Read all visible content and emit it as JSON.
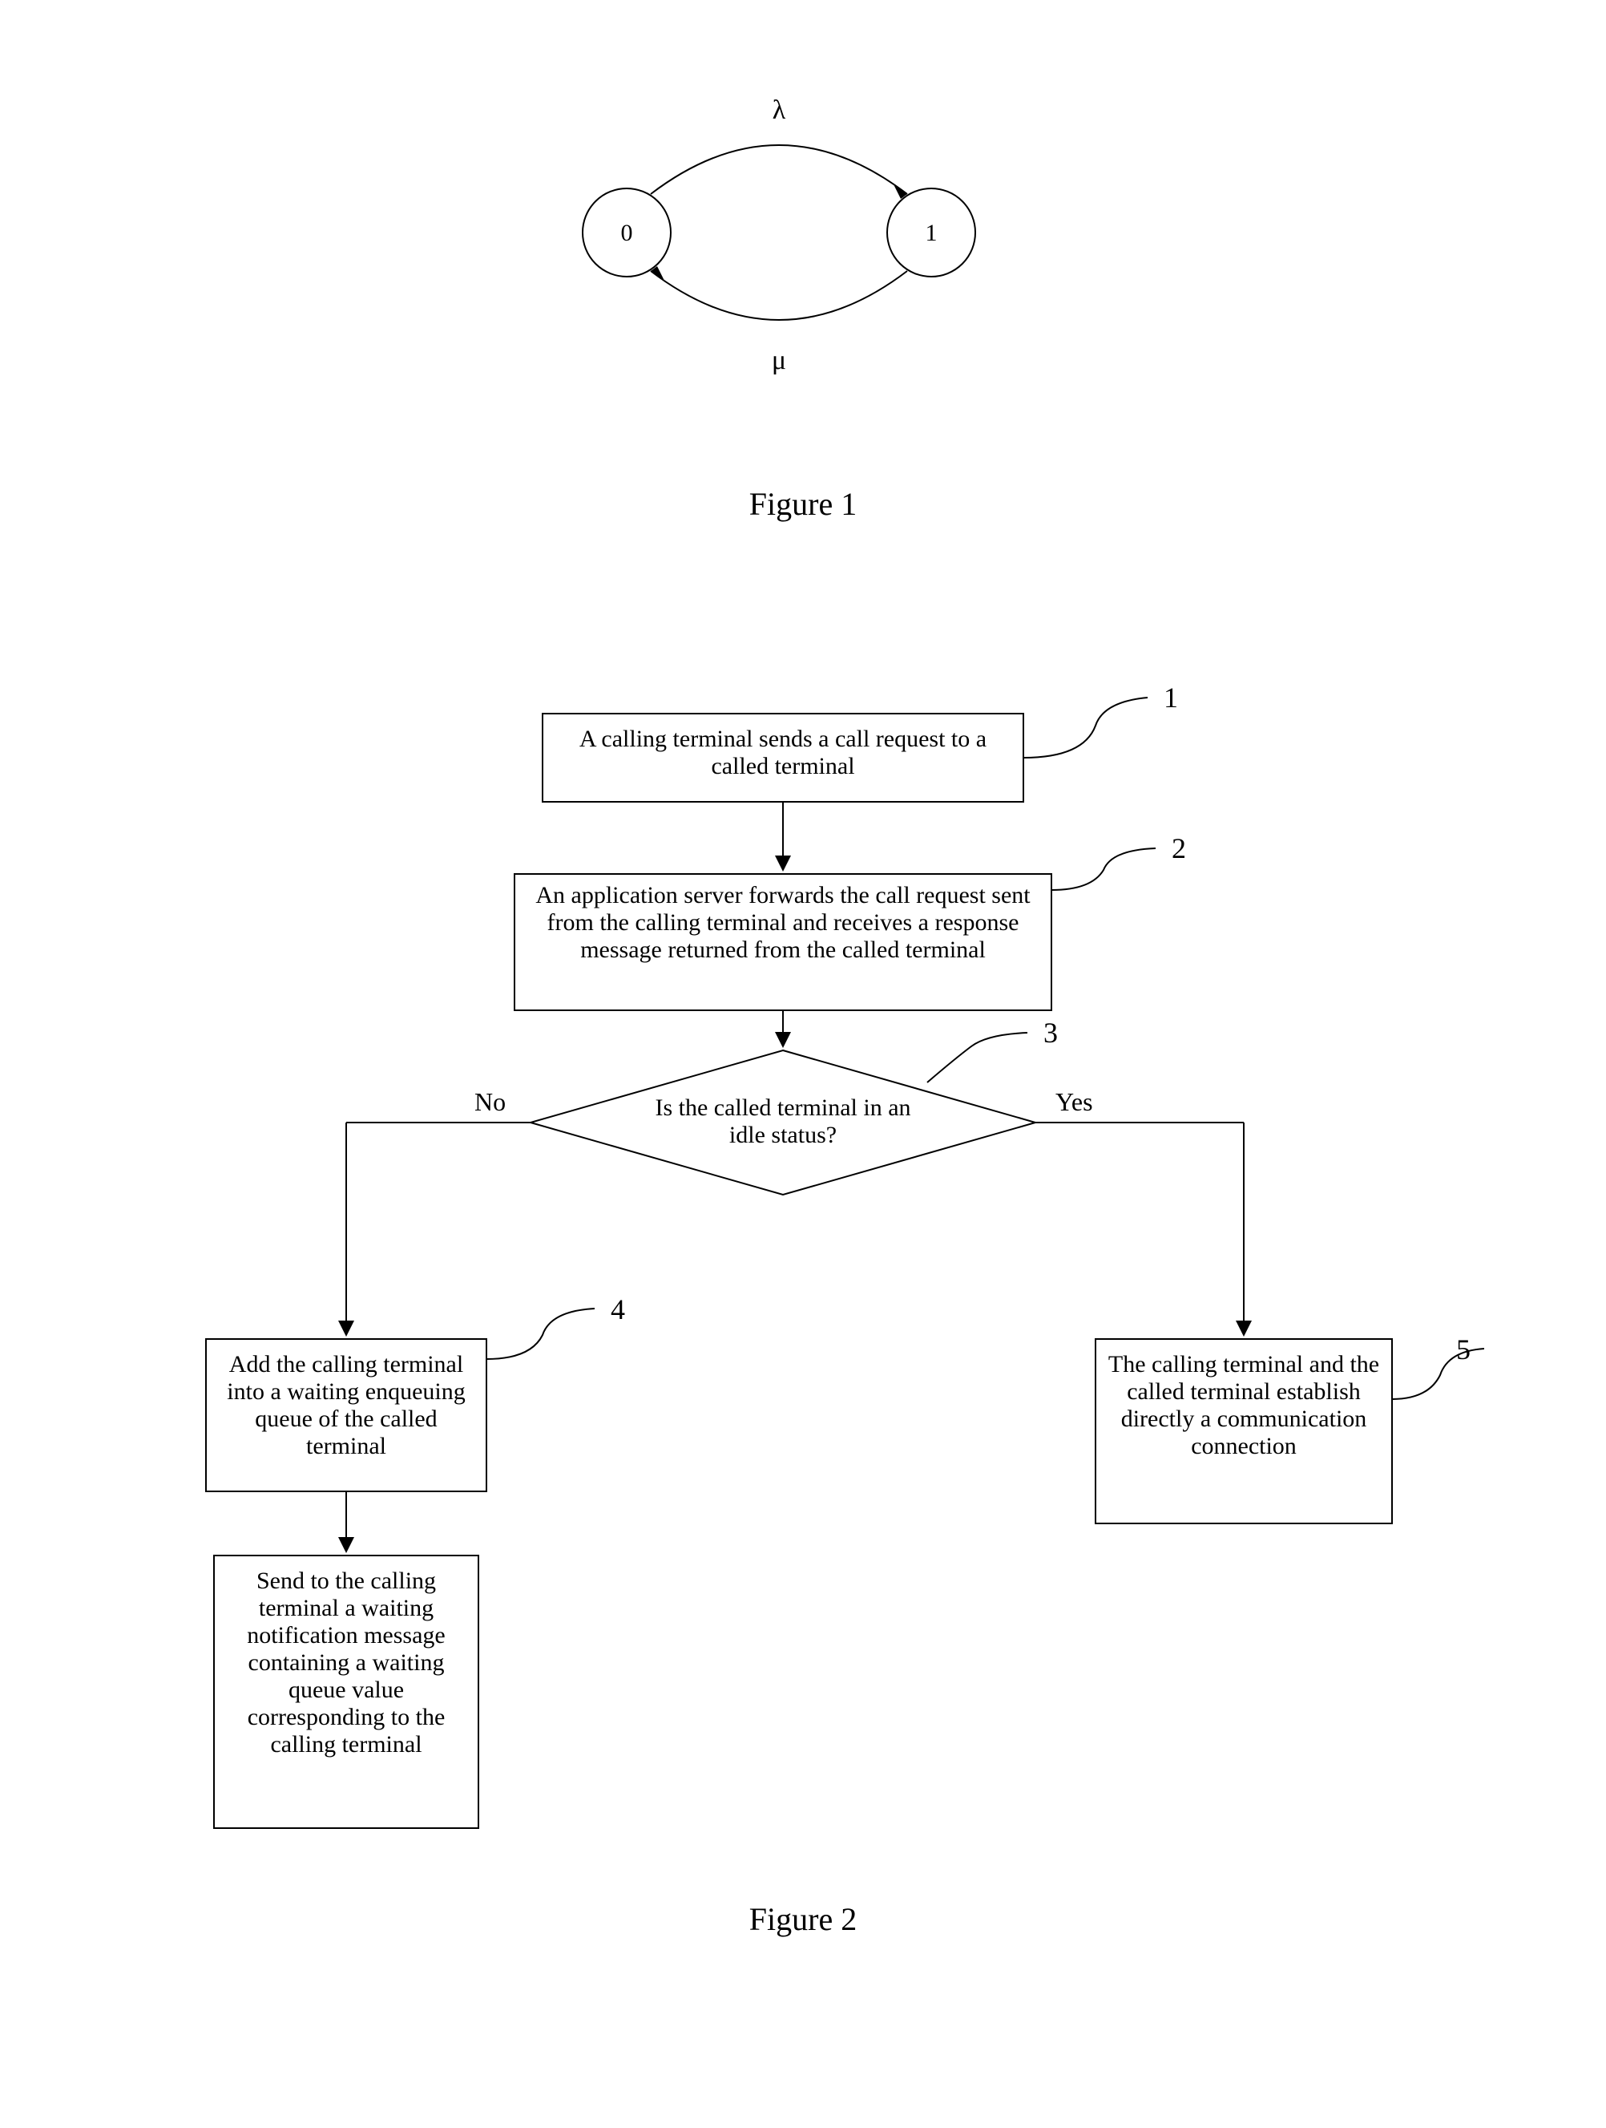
{
  "figure1": {
    "caption": "Figure 1",
    "state0": "0",
    "state1": "1",
    "lambda": "λ",
    "mu": "μ"
  },
  "figure2": {
    "caption": "Figure 2",
    "box1": {
      "text": "A calling terminal sends a call request to a called terminal",
      "label": "1"
    },
    "box2": {
      "text": "An application server forwards the call request sent from the calling terminal and receives a response message returned from the called terminal",
      "label": "2"
    },
    "box3": {
      "text": "Is the called terminal in an idle status?",
      "label": "3",
      "no": "No",
      "yes": "Yes"
    },
    "box4": {
      "text": "Add the calling terminal into a waiting enqueuing queue of the called terminal",
      "label": "4"
    },
    "box5": {
      "text": "The calling terminal and the called terminal establish directly a communication connection",
      "label": "5"
    },
    "box6": {
      "text": "Send to the calling terminal a waiting notification message containing a waiting queue value corresponding to the calling terminal"
    }
  }
}
